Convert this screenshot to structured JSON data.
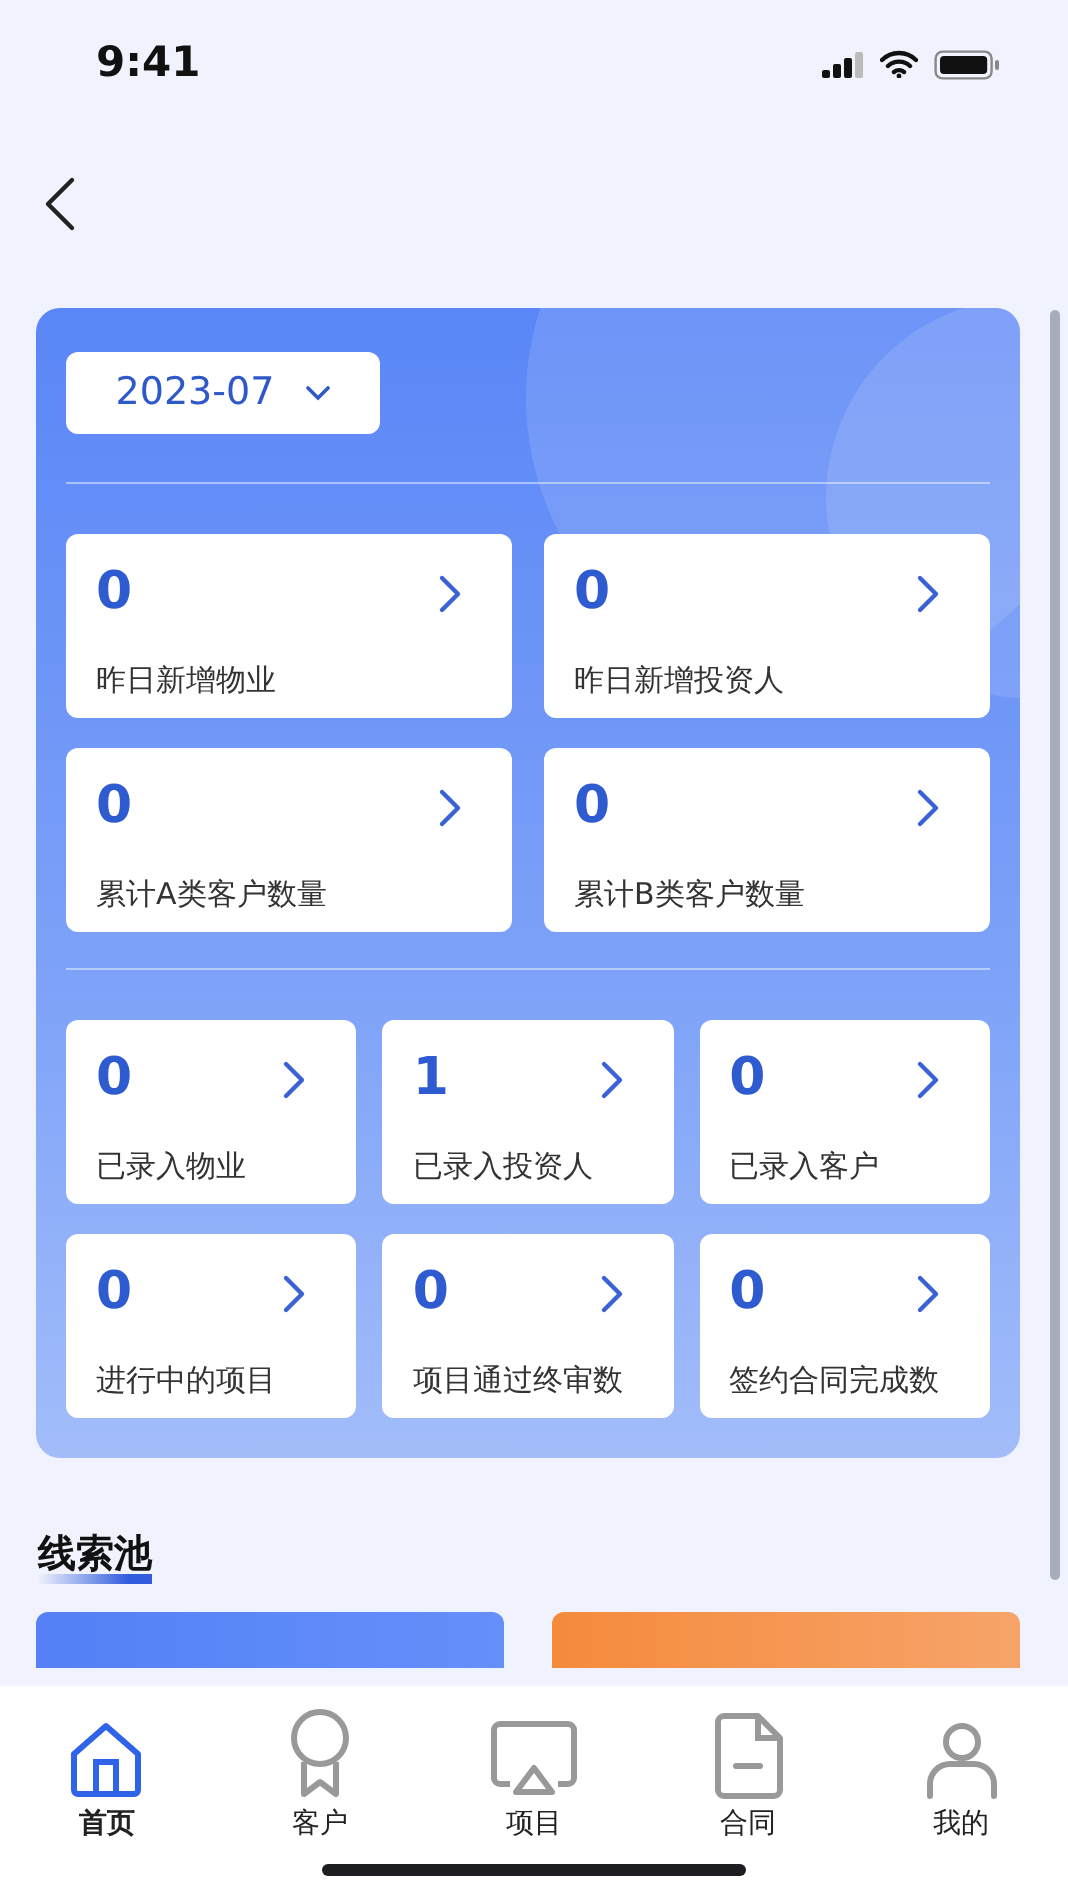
{
  "status_bar": {
    "time": "9:41"
  },
  "date_picker": {
    "value": "2023-07"
  },
  "summary": [
    {
      "value": "0",
      "label": "昨日新增物业"
    },
    {
      "value": "0",
      "label": "昨日新增投资人"
    },
    {
      "value": "0",
      "label": "累计A类客户数量"
    },
    {
      "value": "0",
      "label": "累计B类客户数量"
    }
  ],
  "counts": [
    {
      "value": "0",
      "label": "已录入物业"
    },
    {
      "value": "1",
      "label": "已录入投资人"
    },
    {
      "value": "0",
      "label": "已录入客户"
    },
    {
      "value": "0",
      "label": "进行中的项目"
    },
    {
      "value": "0",
      "label": "项目通过终审数"
    },
    {
      "value": "0",
      "label": "签约合同完成数"
    }
  ],
  "section_title": "线索池",
  "pools": [
    {
      "kind": "blue"
    },
    {
      "kind": "orange"
    }
  ],
  "tab_bar": [
    {
      "label": "首页",
      "selected": true
    },
    {
      "label": "客户",
      "selected": false
    },
    {
      "label": "项目",
      "selected": false
    },
    {
      "label": "合同",
      "selected": false
    },
    {
      "label": "我的",
      "selected": false
    }
  ]
}
